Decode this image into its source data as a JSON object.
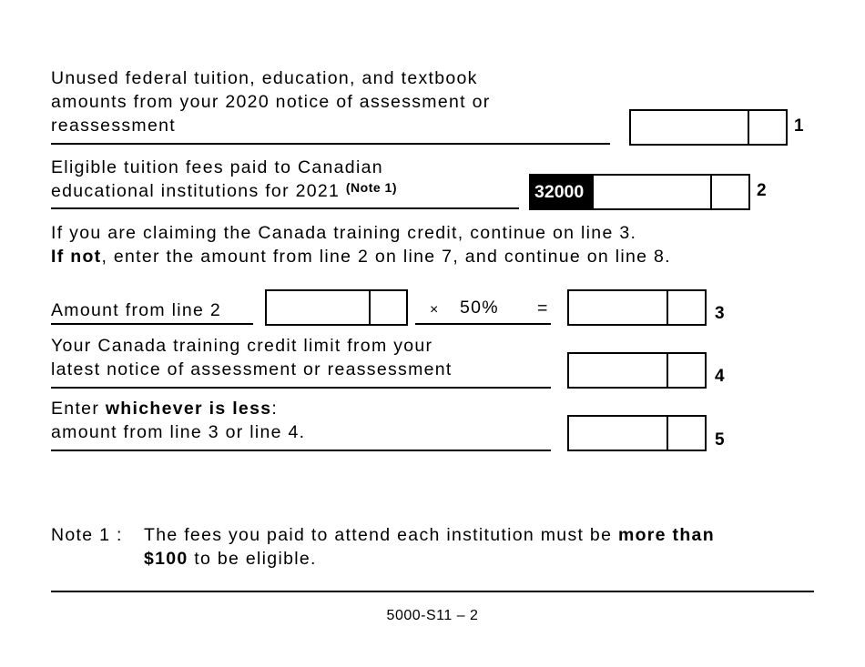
{
  "form": {
    "footer_code": "5000-S11 – 2",
    "line1": {
      "label_lines": [
        "Unused federal tuition, education, and textbook",
        "amounts from your 2020 notice of assessment or",
        "reassessment"
      ],
      "number": "1",
      "dollars": "",
      "cents": ""
    },
    "line2": {
      "label_lines": [
        "Eligible tuition fees paid to Canadian",
        "educational institutions for 2021"
      ],
      "note_ref": "(Note 1)",
      "prefilled_value": "32000",
      "number": "2",
      "dollars": "",
      "cents": ""
    },
    "instructions": {
      "line_a": "If you are claiming the Canada training credit, continue on line 3.",
      "line_b_bold": "If not",
      "line_b_rest": ", enter the amount from line 2 on line 7, and continue on line 8."
    },
    "line3": {
      "label": "Amount from line 2",
      "multiply_symbol": "×",
      "rate": "50%",
      "equals": "=",
      "number": "3",
      "input_dollars": "",
      "input_cents": "",
      "result_dollars": "",
      "result_cents": ""
    },
    "line4": {
      "label_lines": [
        "Your Canada training credit limit from your",
        "latest notice of assessment or reassessment"
      ],
      "number": "4",
      "dollars": "",
      "cents": ""
    },
    "line5": {
      "label_prefix": "Enter ",
      "label_bold": "whichever is less",
      "label_suffix": ":",
      "label_line2": "amount from line 3 or line 4.",
      "number": "5",
      "dollars": "",
      "cents": ""
    },
    "note1": {
      "label": "Note 1 :",
      "text_a": "The fees you paid to attend each institution must be ",
      "bold_a": "more than",
      "bold_b": "$100",
      "text_b": " to be eligible."
    }
  }
}
